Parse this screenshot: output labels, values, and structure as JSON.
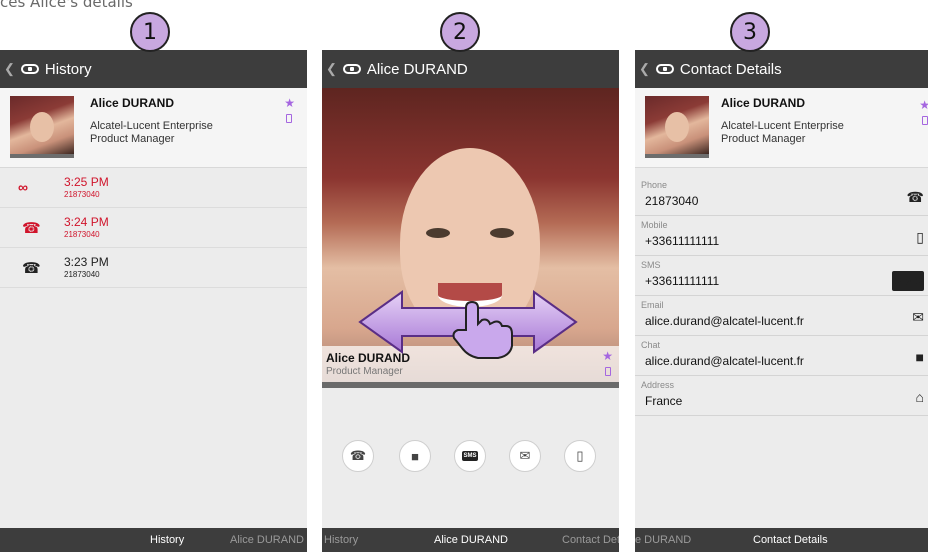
{
  "caption": "ces Alice's details",
  "screens": [
    {
      "badge": "1",
      "title": "History",
      "contact": {
        "name": "Alice DURAND",
        "company": "Alcatel-Lucent Enterprise",
        "role": "Product Manager"
      },
      "history": [
        {
          "time": "3:25 PM",
          "number": "21873040",
          "type": "voicemail-icon",
          "color": "#d0142b"
        },
        {
          "time": "3:24 PM",
          "number": "21873040",
          "type": "missed-call-icon",
          "color": "#d0142b"
        },
        {
          "time": "3:23 PM",
          "number": "21873040",
          "type": "incoming-call-icon",
          "color": "#222222"
        }
      ],
      "tabs": [
        "History",
        "Alice DURAND"
      ]
    },
    {
      "badge": "2",
      "title": "Alice DURAND",
      "contact": {
        "name": "Alice DURAND",
        "role": "Product Manager"
      },
      "actions": [
        "phone-icon",
        "chat-icon",
        "sms-icon",
        "email-icon",
        "mobile-icon"
      ],
      "tabs": [
        "History",
        "Alice DURAND",
        "Contact Det"
      ]
    },
    {
      "badge": "3",
      "title": "Contact Details",
      "contact": {
        "name": "Alice DURAND",
        "company": "Alcatel-Lucent Enterprise",
        "role": "Product Manager"
      },
      "fields": [
        {
          "label": "Phone",
          "value": "21873040",
          "icon": "phone-icon"
        },
        {
          "label": "Mobile",
          "value": "+33611111111",
          "icon": "mobile-icon"
        },
        {
          "label": "SMS",
          "value": "+33611111111",
          "icon": "sms-icon"
        },
        {
          "label": "Email",
          "value": "alice.durand@alcatel-lucent.fr",
          "icon": "email-icon"
        },
        {
          "label": "Chat",
          "value": "alice.durand@alcatel-lucent.fr",
          "icon": "chat-icon"
        },
        {
          "label": "Address",
          "value": "France",
          "icon": "home-icon"
        }
      ],
      "tabs": [
        "e DURAND",
        "Contact Details"
      ]
    }
  ],
  "colors": {
    "accent": "#a566e0",
    "appbar": "#3d3d3d",
    "missed": "#d0142b",
    "badge": "#c8a8e0"
  },
  "sms_icon_text": "SMS"
}
